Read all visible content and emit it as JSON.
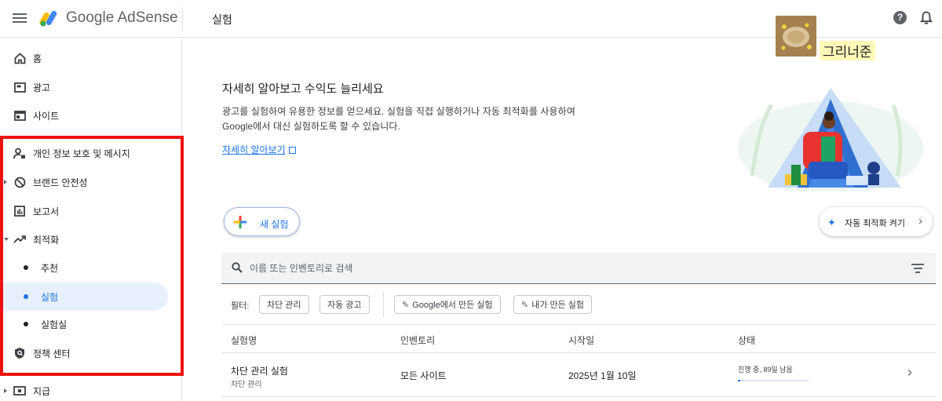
{
  "header": {
    "brand": "Google AdSense",
    "page_title": "실험",
    "help_symbol": "?"
  },
  "user": {
    "name": "그리너준"
  },
  "sidebar": {
    "items": [
      {
        "label": "홈",
        "icon": "home-icon"
      },
      {
        "label": "광고",
        "icon": "ads-icon"
      },
      {
        "label": "사이트",
        "icon": "sites-icon"
      },
      {
        "label": "개인 정보 보호 및 메시지",
        "icon": "privacy-icon"
      },
      {
        "label": "브랜드 안전성",
        "icon": "block-icon"
      },
      {
        "label": "보고서",
        "icon": "reports-icon"
      },
      {
        "label": "최적화",
        "icon": "trending-icon"
      },
      {
        "label": "추천"
      },
      {
        "label": "실험"
      },
      {
        "label": "실험실"
      },
      {
        "label": "정책 센터",
        "icon": "policy-shield-icon"
      },
      {
        "label": "지급",
        "icon": "payments-icon"
      }
    ]
  },
  "intro": {
    "title": "자세히 알아보고 수익도 늘리세요",
    "description": "광고를 실험하여 유용한 정보를 얻으세요. 실험을 직접 실행하거나 자동 최적화를 사용하여 Google에서 대신 실험하도록 할 수 있습니다.",
    "link": "자세히 알아보기"
  },
  "actions": {
    "new_experiment": "새 실험",
    "auto_optimize": "자동 최적화 켜기"
  },
  "search": {
    "placeholder": "이름 또는 인벤토리로 검색"
  },
  "filters": {
    "label": "필터:",
    "chips": [
      "차단 관리",
      "자동 광고",
      "Google에서 만든 실험",
      "내가 만든 실험"
    ]
  },
  "table": {
    "columns": [
      "실험명",
      "인벤토리",
      "시작일",
      "상태"
    ],
    "rows": [
      {
        "name": "차단 관리 실험",
        "type": "차단 관리",
        "inventory": "모든 사이트",
        "start_date": "2025년 1월 10일",
        "status": "진행 중, 89일 남음",
        "progress": 0.03
      }
    ]
  },
  "colors": {
    "accent": "#1a73e8",
    "highlight_box": "#ee1111",
    "active_nav_bg": "#e8f0fe",
    "name_highlight": "#fff9b8"
  }
}
